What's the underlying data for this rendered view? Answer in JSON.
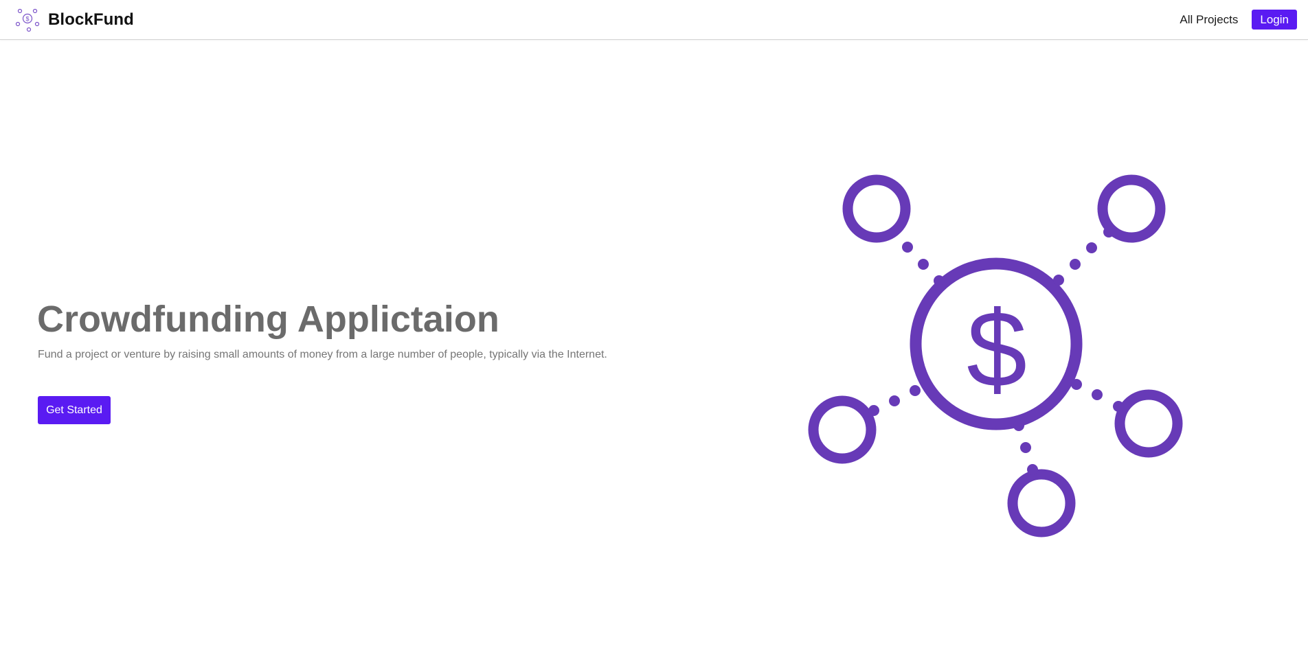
{
  "header": {
    "brand_name": "BlockFund",
    "brand_logo_icon": "crowdfunding-network-icon",
    "nav_links": [
      {
        "label": "All Projects"
      }
    ],
    "login_label": "Login"
  },
  "hero": {
    "title": "Crowdfunding Applictaion",
    "subtitle": "Fund a project or venture by raising small amounts of money from a large number of people, typically via the Internet.",
    "cta_label": "Get Started",
    "illustration_icon": "crowdfunding-network-icon",
    "illustration_symbol": "$"
  },
  "colors": {
    "accent": "#5a1bf2",
    "illustration": "#673ab7",
    "title_text": "#6b6b6b",
    "subtitle_text": "#757575"
  }
}
